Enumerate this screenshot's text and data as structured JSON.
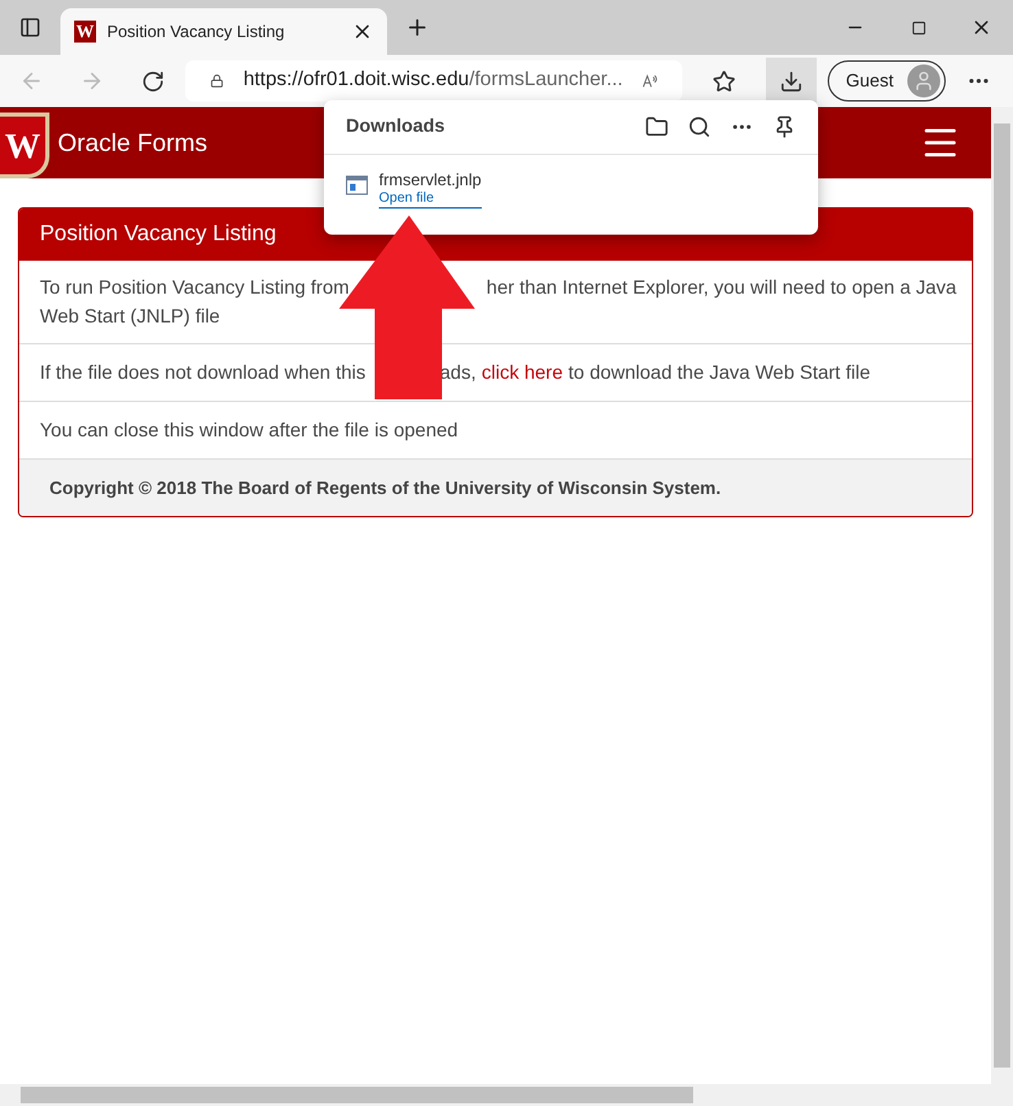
{
  "browser": {
    "tab": {
      "favicon": "W",
      "title": "Position Vacancy Listing",
      "selected": true
    },
    "address": {
      "host": "https://ofr01.doit.wisc.edu",
      "path": "/formsLauncher..."
    },
    "profile": "Guest"
  },
  "downloads": {
    "title": "Downloads",
    "files": [
      {
        "name": "frmservlet.jnlp",
        "action": "Open file"
      }
    ]
  },
  "site_header": {
    "logo": "W",
    "title": "Oracle Forms"
  },
  "card": {
    "title": "Position Vacancy Listing",
    "rows": [
      {
        "kind": "split",
        "lines": [
          [
            "To run Position Vacancy Listing from",
            "her than Internet Explorer, you will need to open a Java"
          ],
          [
            "Web Start (JNLP) file"
          ]
        ]
      },
      {
        "kind": "link",
        "before": "If the file does not download when this",
        "after_gap": "ads,",
        "link": "click here",
        "after": "to download the Java Web Start file"
      },
      {
        "kind": "plain",
        "text": "You can close this window after the file is opened"
      }
    ],
    "footer": "Copyright © 2018 The Board of Regents of the University of Wisconsin System."
  }
}
